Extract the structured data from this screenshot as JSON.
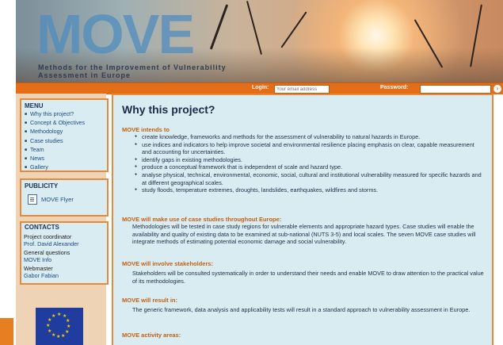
{
  "header": {
    "logo_text": "MOVE",
    "logo_subtitle": "Methods for the Improvement of Vulnerability Assessment in Europe"
  },
  "login": {
    "login_label": "Login:",
    "email_placeholder": "Your email address",
    "password_label": "Password:",
    "go_symbol": "›"
  },
  "sidebar": {
    "menu_title": "MENU",
    "menu_items": [
      "Why this project?",
      "Concept & Objectives",
      "Methodology",
      "Case studies",
      "Team",
      "News",
      "Gallery"
    ],
    "publicity_title": "PUBLICITY",
    "publicity_link": "MOVE Flyer",
    "contacts_title": "CONTACTS",
    "contacts": [
      {
        "role": "Project coordinator",
        "name": "Prof. David Alexander"
      },
      {
        "role": "General questions",
        "name": "MOVE Info"
      },
      {
        "role": "Webmaster",
        "name": "Gabor Fabian"
      }
    ]
  },
  "main": {
    "title": "Why this project?",
    "intends_heading": "MOVE intends to",
    "intends_items": [
      "create knowledge, frameworks and methods for the assessment of vulnerability to natural hazards in Europe.",
      "use indices and indicators to help improve societal and environmental resilience placing emphasis on clear, capable measurement and accounting for uncertainties.",
      "identify gaps in existing methodologies.",
      "produce a conceptual framework that is independent of scale and hazard type.",
      "analyse physical, technical, environmental, economic, social, cultural and institutional vulnerability measured for specific hazards and at different geographical scales.",
      "study floods, temperature extremes, droughts, landslides, earthquakes, wildfires and storms."
    ],
    "casestudies_heading": "MOVE will make use of case studies throughout Europe:",
    "casestudies_text": "Methodologies will be tested in case study regions for vulnerable elements and appropriate hazard types. Case studies will enable the availability and quality of existing data to be examined at sub-national (NUTS 3-5) and local scales. The seven MOVE case studies will integrate methods of estimating potential economic damage and social vulnerability.",
    "stakeholders_heading": "MOVE will involve stakeholders:",
    "stakeholders_text": "Stakeholders will be consulted systematically in order to understand their needs and enable MOVE to draw attention to the practical value of its methodologies.",
    "result_heading": "MOVE will result in:",
    "result_text": "The generic framework, data analysis and applicability tests will result in a standard approach to vulnerability assessment in Europe.",
    "activity_heading": "MOVE activity areas:"
  },
  "colors": {
    "accent_orange": "#e46d17",
    "panel_blue": "#d9ecf2",
    "heading_orange": "#c46014",
    "link_blue": "#1e4a80"
  }
}
